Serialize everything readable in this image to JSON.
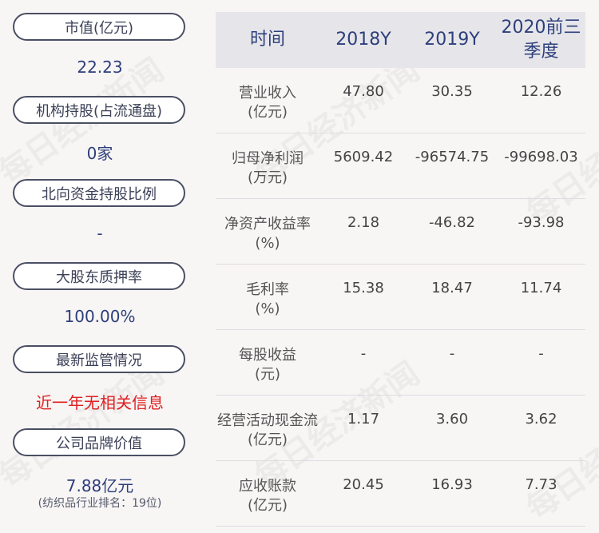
{
  "left_panel": [
    {
      "label": "市值(亿元)",
      "value": "22.23"
    },
    {
      "label": "机构持股(占流通盘)",
      "value": "0家"
    },
    {
      "label": "北向资金持股比例",
      "value": "-"
    },
    {
      "label": "大股东质押率",
      "value": "100.00%"
    },
    {
      "label": "最新监管情况",
      "value": "近一年无相关信息"
    },
    {
      "label": "公司品牌价值",
      "value": "7.88亿元",
      "note": "(纺织品行业排名：19位)"
    }
  ],
  "table": {
    "headers": [
      "时间",
      "2018Y",
      "2019Y",
      "2020前三季度"
    ],
    "rows": [
      {
        "label1": "营业收入",
        "label2": "(亿元)",
        "values": [
          "47.80",
          "30.35",
          "12.26"
        ]
      },
      {
        "label1": "归母净利润",
        "label2": "(万元)",
        "values": [
          "5609.42",
          "-96574.75",
          "-99698.03"
        ]
      },
      {
        "label1": "净资产收益率",
        "label2": "(%)",
        "values": [
          "2.18",
          "-46.82",
          "-93.98"
        ]
      },
      {
        "label1": "毛利率",
        "label2": "(%)",
        "values": [
          "15.38",
          "18.47",
          "11.74"
        ]
      },
      {
        "label1": "每股收益",
        "label2": "(元)",
        "values": [
          "-",
          "-",
          "-"
        ]
      },
      {
        "label1": "经营活动现金流",
        "label2": "(亿元)",
        "values": [
          "1.17",
          "3.60",
          "3.62"
        ]
      },
      {
        "label1": "应收账款",
        "label2": "(亿元)",
        "values": [
          "20.45",
          "16.93",
          "7.73"
        ]
      }
    ]
  },
  "watermark": "每日经济新闻",
  "colors": {
    "value_blue": "#2d3f7a",
    "alert_red": "#e02020",
    "header_bg": "#e6e6ea"
  }
}
